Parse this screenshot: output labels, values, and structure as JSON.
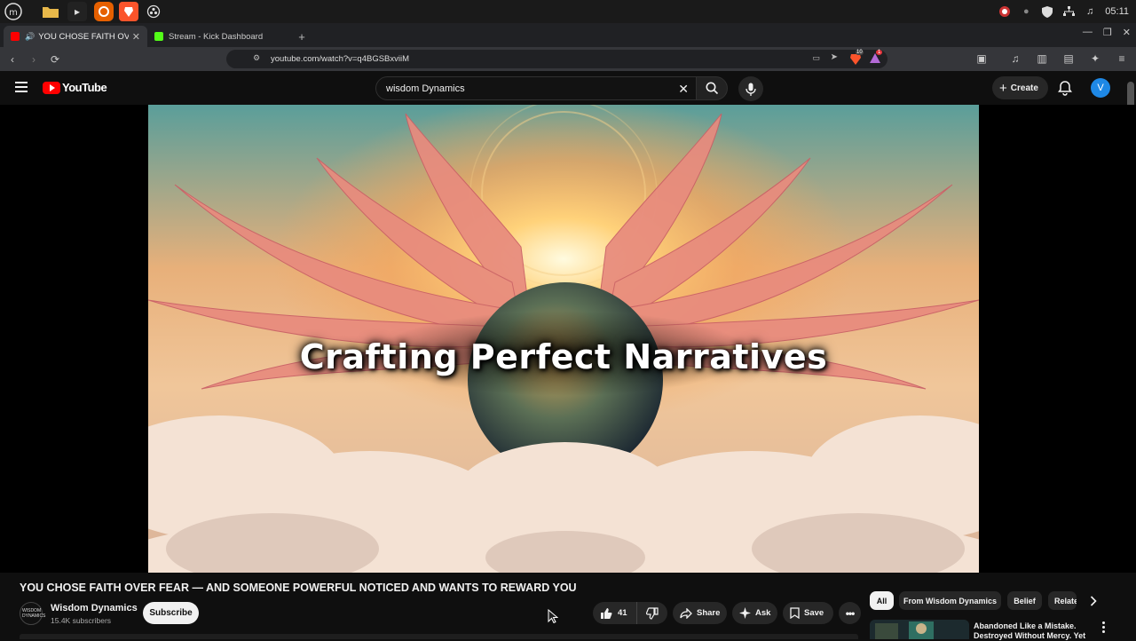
{
  "os": {
    "clock": "05:11",
    "apps": [
      "menu-icon",
      "folder-icon",
      "terminal-icon",
      "firefox-icon",
      "brave-icon",
      "obs-icon"
    ]
  },
  "browser": {
    "tabs": [
      {
        "label": "YOU CHOSE FAITH OVER F",
        "active": true
      },
      {
        "label": "Stream - Kick Dashboard",
        "active": false
      }
    ],
    "url": "youtube.com/watch?v=q4BGSBxviiM",
    "shield_badge": "10",
    "reward_badge": "1"
  },
  "youtube": {
    "logo_text": "YouTube",
    "search_value": "wisdom Dynamics",
    "create_label": "Create",
    "avatar_letter": "V"
  },
  "video": {
    "overlay_text": "Crafting Perfect Narratives",
    "title": "YOU CHOSE FAITH OVER FEAR — AND SOMEONE POWERFUL NOTICED AND WANTS TO REWARD YOU",
    "channel_name": "Wisdom Dynamics",
    "channel_subs": "15.4K subscribers",
    "channel_avatar_text": "WISDOM DYNAMICS",
    "subscribe_label": "Subscribe",
    "like_count": "41",
    "share_label": "Share",
    "ask_label": "Ask",
    "save_label": "Save"
  },
  "chips": [
    "All",
    "From Wisdom Dynamics",
    "Belief",
    "Relate"
  ],
  "recommendation": {
    "title": "Abandoned Like a Mistake. Destroyed Without Mercy. Yet"
  },
  "colors": {
    "youtube_red": "#ff0000",
    "avatar_blue": "#1e88e5",
    "background": "#0f0f0f"
  }
}
